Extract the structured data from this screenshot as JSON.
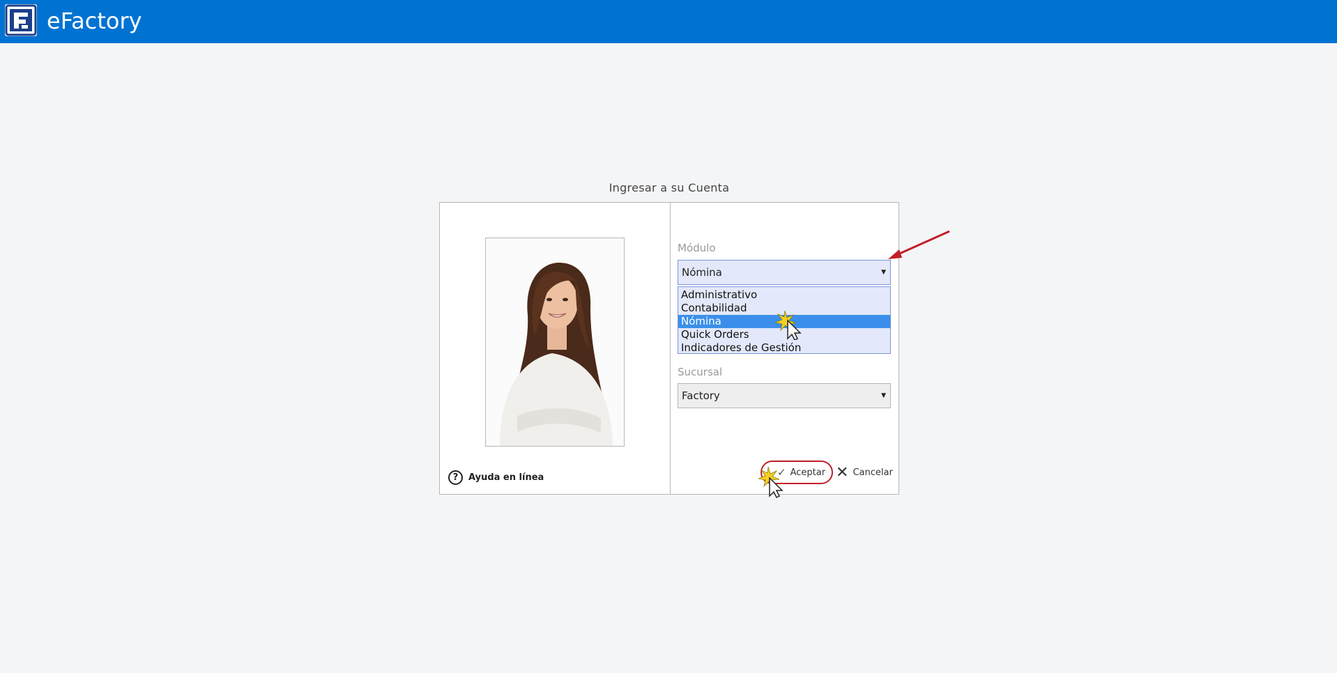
{
  "header": {
    "app_title": "eFactory",
    "logo_icon": "efactory-logo-icon",
    "bar_color": "#0073d2"
  },
  "dialog": {
    "title": "Ingresar a su Cuenta",
    "help_label": "Ayuda en línea",
    "help_icon": "question-circle-icon",
    "modulo": {
      "label": "Módulo",
      "selected": "Nómina",
      "options": [
        "Administrativo",
        "Contabilidad",
        "Nómina",
        "Quick Orders",
        "Indicadores de Gestión"
      ],
      "highlighted_index": 2
    },
    "sucursal": {
      "label": "Sucursal",
      "selected": "Factory"
    },
    "accept_label": "Aceptar",
    "cancel_label": "Cancelar"
  },
  "colors": {
    "highlight": "#3b8fea",
    "dropdown_bg": "#e3e8fa",
    "annotation_red": "#c0202a"
  }
}
